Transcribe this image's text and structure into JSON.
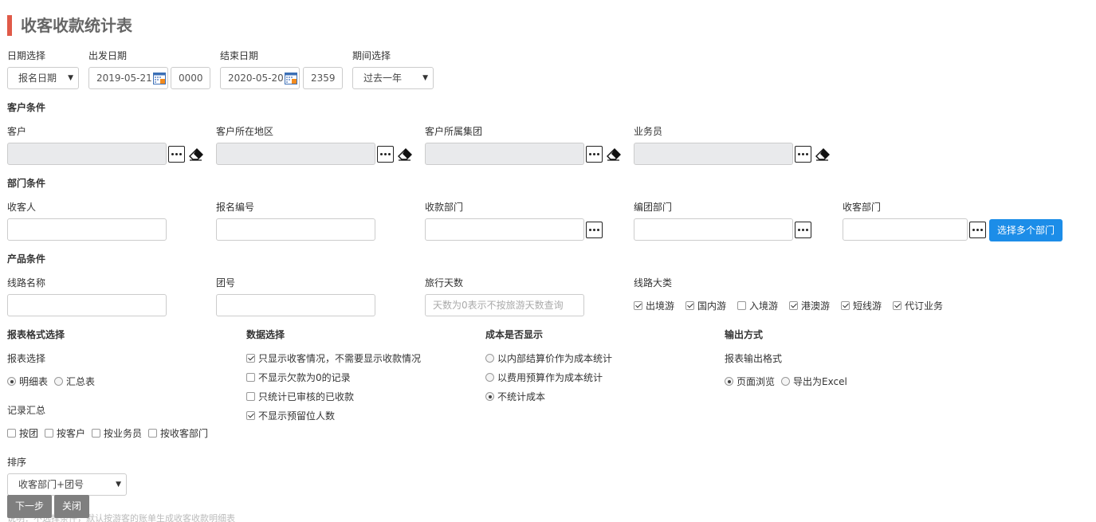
{
  "page_title": "收客收款统计表",
  "date": {
    "type_label": "日期选择",
    "type_value": "报名日期",
    "start_label": "出发日期",
    "start_value": "2019-05-21",
    "start_time": "0000",
    "end_label": "结束日期",
    "end_value": "2020-05-20",
    "end_time": "2359",
    "period_label": "期间选择",
    "period_value": "过去一年"
  },
  "customer": {
    "section": "客户条件",
    "customer_label": "客户",
    "region_label": "客户所在地区",
    "group_label": "客户所属集团",
    "sales_label": "业务员"
  },
  "dept": {
    "section": "部门条件",
    "receiver_label": "收客人",
    "signup_no_label": "报名编号",
    "payment_dept_label": "收款部门",
    "tour_dept_label": "编团部门",
    "receive_dept_label": "收客部门",
    "multi_dept_button": "选择多个部门"
  },
  "product": {
    "section": "产品条件",
    "route_label": "线路名称",
    "group_no_label": "团号",
    "days_label": "旅行天数",
    "days_placeholder": "天数为0表示不按旅游天数查询",
    "category_label": "线路大类",
    "categories": [
      {
        "label": "出境游",
        "checked": true
      },
      {
        "label": "国内游",
        "checked": true
      },
      {
        "label": "入境游",
        "checked": false
      },
      {
        "label": "港澳游",
        "checked": true
      },
      {
        "label": "短线游",
        "checked": true
      },
      {
        "label": "代订业务",
        "checked": true
      }
    ]
  },
  "report_format": {
    "section": "报表格式选择",
    "report_label": "报表选择",
    "report_options": [
      {
        "label": "明细表",
        "checked": true
      },
      {
        "label": "汇总表",
        "checked": false
      }
    ],
    "summary_label": "记录汇总",
    "summary_options": [
      {
        "label": "按团",
        "checked": false
      },
      {
        "label": "按客户",
        "checked": false
      },
      {
        "label": "按业务员",
        "checked": false
      },
      {
        "label": "按收客部门",
        "checked": false
      }
    ],
    "sort_label": "排序",
    "sort_value": "收客部门+团号"
  },
  "data_select": {
    "section": "数据选择",
    "options": [
      {
        "label": "只显示收客情况，不需要显示收款情况",
        "checked": true
      },
      {
        "label": "不显示欠款为0的记录",
        "checked": false
      },
      {
        "label": "只统计已审核的已收款",
        "checked": false
      },
      {
        "label": "不显示预留位人数",
        "checked": true
      }
    ]
  },
  "cost_display": {
    "section": "成本是否显示",
    "options": [
      {
        "label": "以内部结算价作为成本统计",
        "checked": false
      },
      {
        "label": "以费用预算作为成本统计",
        "checked": false
      },
      {
        "label": "不统计成本",
        "checked": true
      }
    ]
  },
  "output": {
    "section": "输出方式",
    "format_label": "报表输出格式",
    "options": [
      {
        "label": "页面浏览",
        "checked": true
      },
      {
        "label": "导出为Excel",
        "checked": false
      }
    ]
  },
  "footer": {
    "next_button": "下一步",
    "close_button": "关闭",
    "note": "说明：不选择条件，默认按游客的账单生成收客收款明细表"
  },
  "colors": {
    "accent_bar": "#e05a48",
    "primary_button": "#1c8de8",
    "footer_button": "#7f7f7f",
    "readonly_field": "#e9eaec"
  }
}
